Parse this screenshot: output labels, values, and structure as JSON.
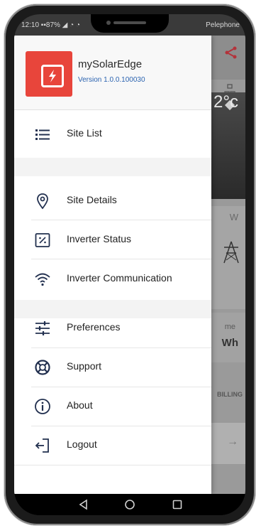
{
  "status_bar": {
    "time_battery": "12:10 ▪▪87% ◢ ◔ ◔",
    "carrier": "Pelephone"
  },
  "app": {
    "name": "mySolarEdge",
    "version": "Version 1.0.0.100030"
  },
  "menu": {
    "site_list": "Site List",
    "site_details": "Site Details",
    "inverter_status": "Inverter Status",
    "inverter_communication": "Inverter Communication",
    "preferences": "Preferences",
    "support": "Support",
    "about": "About",
    "logout": "Logout"
  },
  "background": {
    "temperature": "2°c",
    "home_label": "me",
    "energy_unit": "Wh",
    "billing_label": "BILLING",
    "power_unit": "W"
  },
  "colors": {
    "brand_red": "#e8453b",
    "version_blue": "#2b63b0",
    "icon_navy": "#22304f"
  }
}
